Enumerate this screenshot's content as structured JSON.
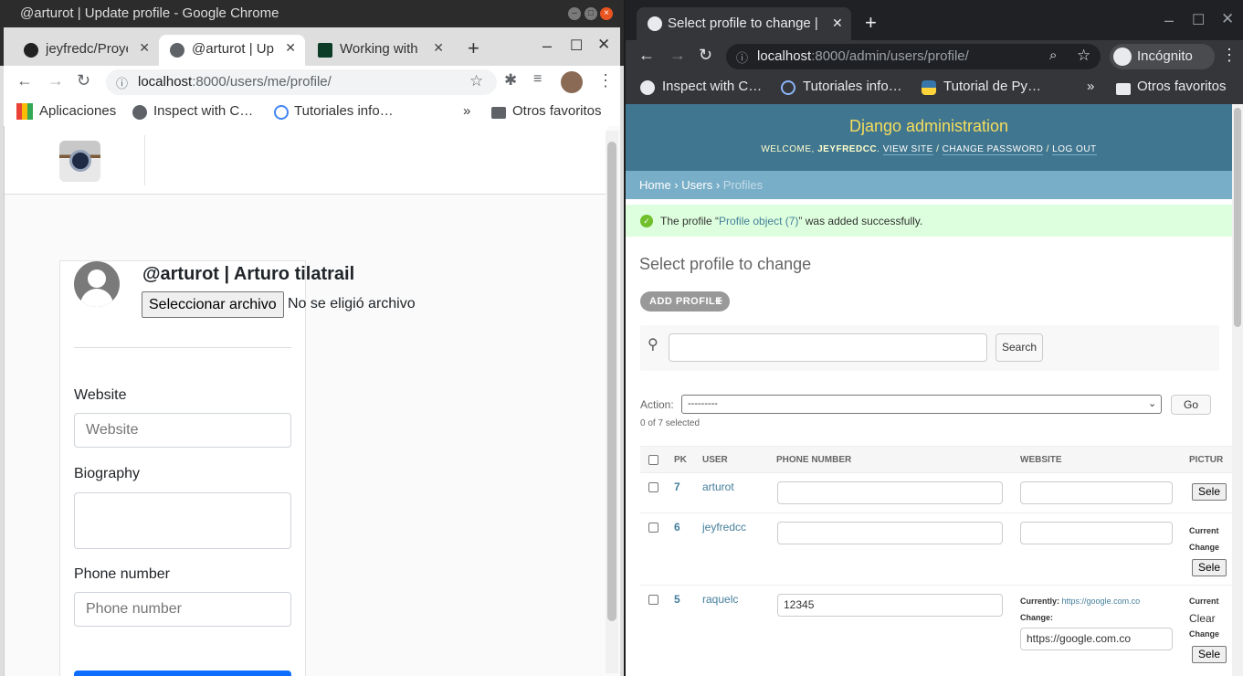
{
  "left": {
    "window_title": "@arturot | Update profile - Google Chrome",
    "tabs": [
      {
        "label": "jeyfredc/Proye",
        "icon": "github-icon"
      },
      {
        "label": "@arturot | Up",
        "icon": "globe-icon"
      },
      {
        "label": "Working with",
        "icon": "django-icon"
      }
    ],
    "url_host": "localhost",
    "url_rest": ":8000/users/me/profile/",
    "bookmarks": [
      "Aplicaciones",
      "Inspect with C…",
      "Tutoriales info…",
      "»",
      "Otros favoritos"
    ],
    "profile": {
      "username": "@arturot | Arturo tilatrail",
      "file_button": "Seleccionar archivo",
      "file_status": "No se eligió archivo",
      "website_label": "Website",
      "website_placeholder": "Website",
      "biography_label": "Biography",
      "phone_label": "Phone number",
      "phone_placeholder": "Phone number"
    }
  },
  "right": {
    "tab_label": "Select profile to change |",
    "url_host": "localhost",
    "url_rest": ":8000/admin/users/profile/",
    "incognito": "Incógnito",
    "bookmarks": [
      "Inspect with C…",
      "Tutoriales info…",
      "Tutorial de Py…",
      "»",
      "Otros favoritos"
    ],
    "admin": {
      "site_title": "Django administration",
      "welcome": "WELCOME,",
      "user": "JEYFREDCC",
      "view_site": "VIEW SITE",
      "change_password": "CHANGE PASSWORD",
      "log_out": "LOG OUT",
      "sep": "/",
      "crumb_home": "Home",
      "crumb_users": "Users",
      "crumb_profiles": "Profiles",
      "msg_prefix": "The profile “",
      "msg_link": "Profile object (7)",
      "msg_suffix": "” was added successfully.",
      "page_title": "Select profile to change",
      "add_button": "ADD PROFILE",
      "search_button": "Search",
      "action_label": "Action:",
      "action_value": "---------",
      "go_button": "Go",
      "selected_count": "0 of 7 selected",
      "columns": [
        "PK",
        "USER",
        "PHONE NUMBER",
        "WEBSITE",
        "PICTUR"
      ],
      "rows": [
        {
          "pk": "7",
          "user": "arturot",
          "phone": "",
          "website": ""
        },
        {
          "pk": "6",
          "user": "jeyfredcc",
          "phone": "",
          "website": ""
        },
        {
          "pk": "5",
          "user": "raquelc",
          "phone": "12345",
          "website": "https://google.com.co"
        }
      ],
      "currently_label": "Currently:",
      "currently_link": "https://google.com.co",
      "change_label": "Change:",
      "picture_currently": "Current",
      "picture_change": "Change",
      "picture_clear": "Clear",
      "picture_button": "Sele"
    }
  }
}
